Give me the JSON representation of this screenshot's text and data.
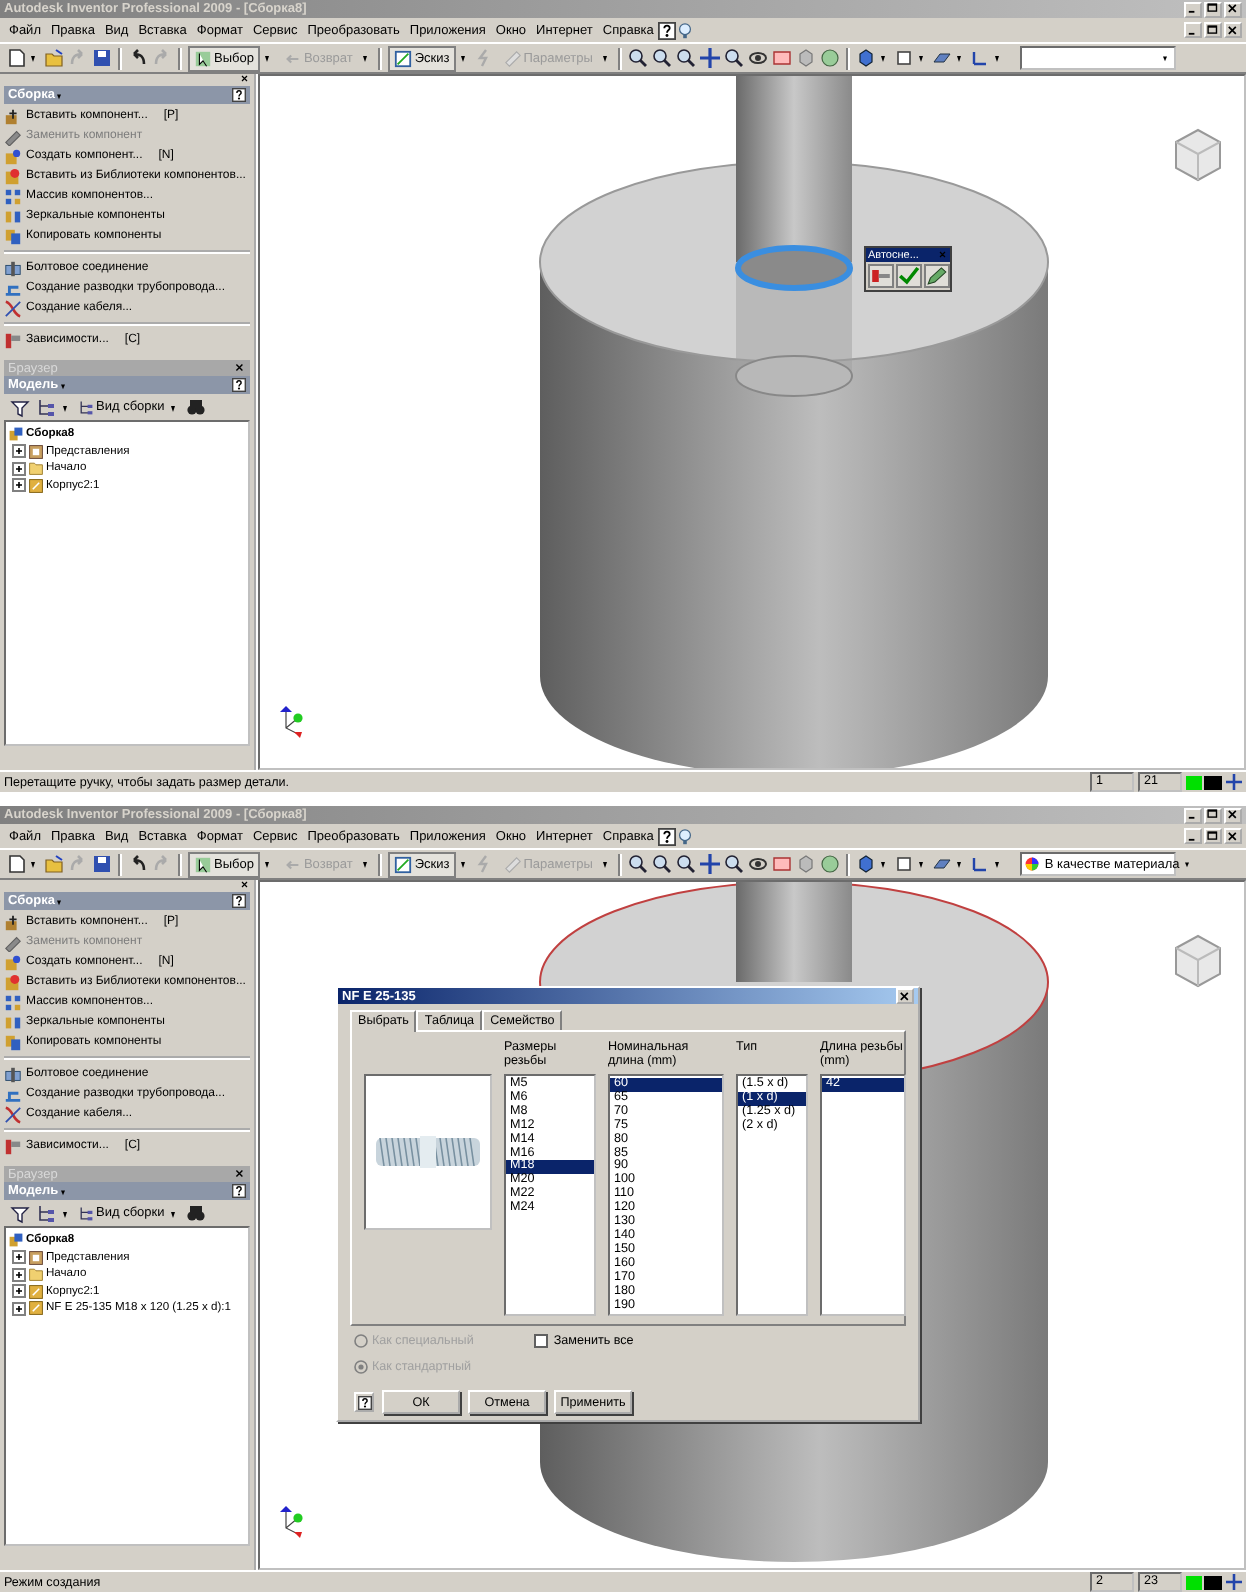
{
  "windows": [
    {
      "title": "Autodesk Inventor Professional 2009 - [Сборка8]",
      "menu": [
        "Файл",
        "Правка",
        "Вид",
        "Вставка",
        "Формат",
        "Сервис",
        "Преобразовать",
        "Приложения",
        "Окно",
        "Интернет",
        "Справка"
      ],
      "toolbar": {
        "buttons": [
          {
            "label": "Выбор",
            "disabled": false
          },
          {
            "label": "Возврат",
            "disabled": true
          },
          {
            "label": "Эскиз",
            "disabled": false
          },
          {
            "label": "Параметры",
            "disabled": true
          }
        ]
      },
      "panel": {
        "title": "Сборка",
        "items": [
          {
            "label": "Вставить компонент...",
            "shortcut": "[P]",
            "disabled": false,
            "separator": false
          },
          {
            "label": "Заменить компонент",
            "disabled": true,
            "separator": false
          },
          {
            "label": "Создать компонент...",
            "shortcut": "[N]",
            "disabled": false,
            "separator": false
          },
          {
            "label": "Вставить из Библиотеки компонентов...",
            "disabled": false,
            "separator": false
          },
          {
            "label": "Массив компонентов...",
            "disabled": false,
            "separator": false
          },
          {
            "label": "Зеркальные компоненты",
            "disabled": false,
            "separator": false
          },
          {
            "label": "Копировать компоненты",
            "disabled": false,
            "separator": false
          },
          {
            "label": "Болтовое соединение",
            "disabled": false,
            "separator": true
          },
          {
            "label": "Создание разводки трубопровода...",
            "disabled": false,
            "separator": false
          },
          {
            "label": "Создание кабеля...",
            "disabled": false,
            "separator": false
          },
          {
            "label": "Зависимости...",
            "shortcut": "[C]",
            "disabled": false,
            "separator": true
          }
        ]
      },
      "browser": {
        "title": "Браузер",
        "header": "Модель",
        "view": "Вид сборки",
        "tree": [
          {
            "label": "Сборка8",
            "kind": "assembly",
            "children": [
              {
                "label": "Представления",
                "kind": "representations",
                "expanded": false
              },
              {
                "label": "Начало",
                "kind": "folder",
                "expanded": false
              },
              {
                "label": "Корпус2:1",
                "kind": "part",
                "expanded": false
              }
            ]
          }
        ]
      },
      "mini_toolbar": {
        "title": "Автосне..."
      },
      "status": {
        "text": "Перетащите ручку, чтобы задать размер детали.",
        "cells": [
          "1",
          "21"
        ]
      }
    },
    {
      "title": "Autodesk Inventor Professional 2009 - [Сборка8]",
      "menu": [
        "Файл",
        "Правка",
        "Вид",
        "Вставка",
        "Формат",
        "Сервис",
        "Преобразовать",
        "Приложения",
        "Окно",
        "Интернет",
        "Справка"
      ],
      "toolbar": {
        "buttons": [
          {
            "label": "Выбор",
            "disabled": false
          },
          {
            "label": "Возврат",
            "disabled": true
          },
          {
            "label": "Эскиз",
            "disabled": false
          },
          {
            "label": "Параметры",
            "disabled": true
          }
        ],
        "combo": "В качестве материала"
      },
      "panel": {
        "title": "Сборка",
        "items": [
          {
            "label": "Вставить компонент...",
            "shortcut": "[P]",
            "disabled": false,
            "separator": false
          },
          {
            "label": "Заменить компонент",
            "disabled": true,
            "separator": false
          },
          {
            "label": "Создать компонент...",
            "shortcut": "[N]",
            "disabled": false,
            "separator": false
          },
          {
            "label": "Вставить из Библиотеки компонентов...",
            "disabled": false,
            "separator": false
          },
          {
            "label": "Массив компонентов...",
            "disabled": false,
            "separator": false
          },
          {
            "label": "Зеркальные компоненты",
            "disabled": false,
            "separator": false
          },
          {
            "label": "Копировать компоненты",
            "disabled": false,
            "separator": false
          },
          {
            "label": "Болтовое соединение",
            "disabled": false,
            "separator": true
          },
          {
            "label": "Создание разводки трубопровода...",
            "disabled": false,
            "separator": false
          },
          {
            "label": "Создание кабеля...",
            "disabled": false,
            "separator": false
          },
          {
            "label": "Зависимости...",
            "shortcut": "[C]",
            "disabled": false,
            "separator": true
          }
        ]
      },
      "browser": {
        "title": "Браузер",
        "header": "Модель",
        "view": "Вид сборки",
        "tree": [
          {
            "label": "Сборка8",
            "kind": "assembly",
            "children": [
              {
                "label": "Представления",
                "kind": "representations",
                "expanded": false
              },
              {
                "label": "Начало",
                "kind": "folder",
                "expanded": false
              },
              {
                "label": "Корпус2:1",
                "kind": "part",
                "expanded": false
              },
              {
                "label": "NF E 25-135 M18 x 120 (1.25 x d):1",
                "kind": "part",
                "expanded": false
              }
            ]
          }
        ]
      },
      "dialog": {
        "title": "NF E 25-135",
        "tabs": [
          {
            "label": "Выбрать",
            "selected": true
          },
          {
            "label": "Таблица",
            "selected": false
          },
          {
            "label": "Семейство",
            "selected": false
          }
        ],
        "columns": [
          {
            "header": "Размеры резьбы",
            "items": [
              {
                "label": "M5",
                "selected": false
              },
              {
                "label": "M6",
                "selected": false
              },
              {
                "label": "M8",
                "selected": false
              },
              {
                "label": "M12",
                "selected": false
              },
              {
                "label": "M14",
                "selected": false
              },
              {
                "label": "M16",
                "selected": false
              },
              {
                "label": "M18",
                "selected": true
              },
              {
                "label": "M20",
                "selected": false
              },
              {
                "label": "M22",
                "selected": false
              },
              {
                "label": "M24",
                "selected": false
              }
            ]
          },
          {
            "header": "Номинальная длина (mm)",
            "items": [
              {
                "label": "60",
                "selected": true
              },
              {
                "label": "65",
                "selected": false
              },
              {
                "label": "70",
                "selected": false
              },
              {
                "label": "75",
                "selected": false
              },
              {
                "label": "80",
                "selected": false
              },
              {
                "label": "85",
                "selected": false
              },
              {
                "label": "90",
                "selected": false
              },
              {
                "label": "100",
                "selected": false
              },
              {
                "label": "110",
                "selected": false
              },
              {
                "label": "120",
                "selected": false
              },
              {
                "label": "130",
                "selected": false
              },
              {
                "label": "140",
                "selected": false
              },
              {
                "label": "150",
                "selected": false
              },
              {
                "label": "160",
                "selected": false
              },
              {
                "label": "170",
                "selected": false
              },
              {
                "label": "180",
                "selected": false
              },
              {
                "label": "190",
                "selected": false
              }
            ]
          },
          {
            "header": "Тип",
            "items": [
              {
                "label": "(1.5 x d)",
                "selected": false
              },
              {
                "label": "(1 x d)",
                "selected": true
              },
              {
                "label": "(1.25 x d)",
                "selected": false
              },
              {
                "label": "(2 x d)",
                "selected": false
              }
            ]
          },
          {
            "header": "Длина резьбы (mm)",
            "items": [
              {
                "label": "42",
                "selected": true
              }
            ]
          }
        ],
        "radios": [
          {
            "label": "Как специальный",
            "selected": false,
            "disabled": true
          },
          {
            "label": "Как стандартный",
            "selected": true,
            "disabled": true
          }
        ],
        "checkbox": {
          "label": "Заменить все",
          "checked": false
        },
        "buttons": [
          "ОК",
          "Отмена",
          "Применить"
        ]
      },
      "status": {
        "text": "Режим создания",
        "cells": [
          "2",
          "23"
        ]
      }
    }
  ]
}
